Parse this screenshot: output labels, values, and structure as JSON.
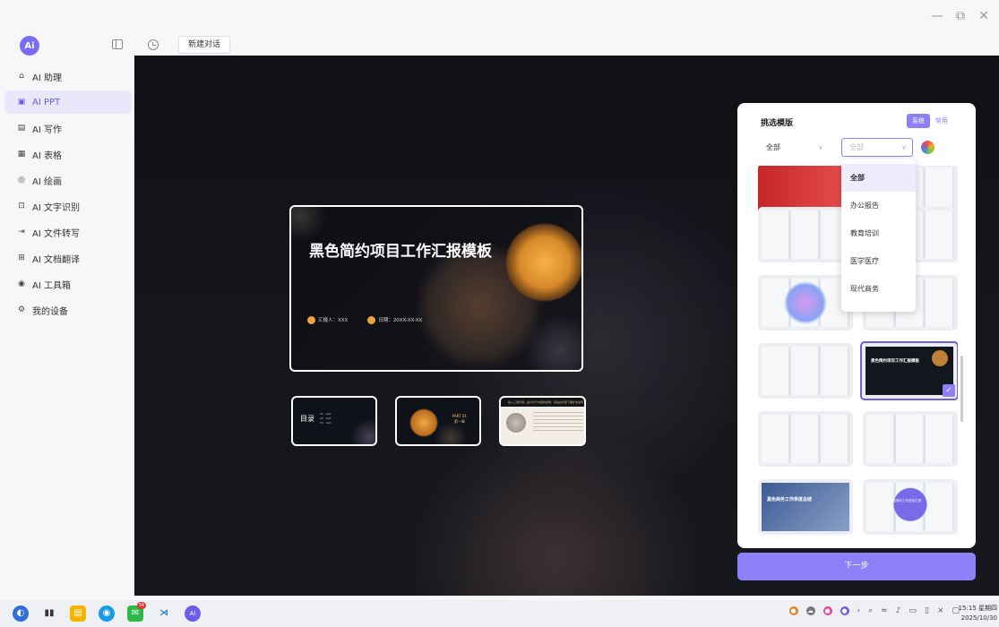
{
  "window": {
    "controls": [
      "—",
      "⧉",
      "✕"
    ]
  },
  "sidebar": {
    "logo": "Ai",
    "items": [
      {
        "label": "AI 助理",
        "icon": "robot-icon",
        "glyph": "⌂"
      },
      {
        "label": "AI PPT",
        "icon": "ppt-icon",
        "glyph": "▣"
      },
      {
        "label": "AI 写作",
        "icon": "write-icon",
        "glyph": "▤"
      },
      {
        "label": "AI 表格",
        "icon": "table-icon",
        "glyph": "▦"
      },
      {
        "label": "AI 绘画",
        "icon": "paint-icon",
        "glyph": "◎"
      },
      {
        "label": "AI 文字识别",
        "icon": "ocr-icon",
        "glyph": "⊡"
      },
      {
        "label": "AI 文件转写",
        "icon": "transcribe-icon",
        "glyph": "⇥"
      },
      {
        "label": "AI 文档翻译",
        "icon": "translate-icon",
        "glyph": "⊞"
      },
      {
        "label": "AI 工具箱",
        "icon": "toolbox-icon",
        "glyph": "◉"
      },
      {
        "label": "我的设备",
        "icon": "device-icon",
        "glyph": "⚙"
      }
    ],
    "active_index": 1
  },
  "topbar": {
    "new_chat": "新建对话"
  },
  "slide": {
    "title": "黑色简约项目工作汇报模板",
    "reporter": "汇报人：XXX",
    "date": "日期：20XX-XX-XX"
  },
  "thumbs": {
    "toc": "目录",
    "toc_lines": "01 · text\n02 · text\n03 · text",
    "part": "PART 01\n第一章",
    "band": "输入三级标题，是为对于内容的说明，就是在标题下面补充说明"
  },
  "panel": {
    "title": "挑选模版",
    "tab_system": "系统",
    "tab_common": "常用",
    "filter1": "全部",
    "filter2": "全部",
    "card_dark_title": "黑色简约项目工作汇报模板",
    "card_blue_title": "黑色商务工作季度总结",
    "card_purple_title": "紫色简约工作总结汇报"
  },
  "dropdown": {
    "options": [
      "全部",
      "办公报告",
      "教育培训",
      "医学医疗",
      "现代商务"
    ],
    "selected_index": 0
  },
  "next_button": "下一步",
  "taskbar": {
    "badge": "34",
    "time": "15:15 星期四",
    "date": "2025/10/30"
  },
  "colors": {
    "accent": "#8d7ff5",
    "accent_dark": "#6c5ce7",
    "orange": "#f0a33c"
  }
}
